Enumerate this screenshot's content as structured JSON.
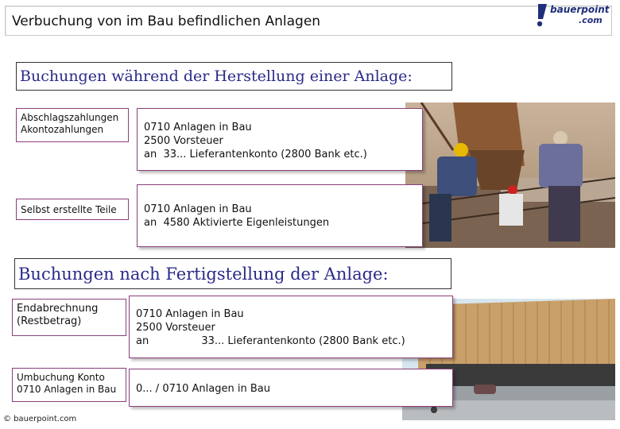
{
  "header": {
    "title": "Verbuchung von im Bau befindlichen Anlagen",
    "logo_brand": "bauerpoint",
    "logo_suffix": ".com"
  },
  "section1": {
    "heading": "Buchungen während der Herstellung einer Anlage:",
    "rows": [
      {
        "label": "Abschlagszahlungen\nAkontozahlungen",
        "entry": "0710 Anlagen in Bau\n2500 Vorsteuer\nan  33... Lieferantenkonto (2800 Bank etc.)"
      },
      {
        "label": "Selbst erstellte Teile",
        "entry": "0710 Anlagen in Bau\nan  4580 Aktivierte Eigenleistungen"
      }
    ]
  },
  "section2": {
    "heading": "Buchungen nach Fertigstellung der Anlage:",
    "rows": [
      {
        "label": "Endabrechnung\n(Restbetrag)",
        "entry": "0710 Anlagen in Bau\n2500 Vorsteuer\nan                33... Lieferantenkonto (2800 Bank etc.)"
      },
      {
        "label": "Umbuchung Konto\n0710 Anlagen in Bau",
        "entry": "0... / 0710 Anlagen in Bau"
      }
    ]
  },
  "footer": {
    "copyright": "© bauerpoint.com"
  },
  "images": {
    "photo1": "construction-workers-photo",
    "photo2": "wooden-building-photo"
  }
}
